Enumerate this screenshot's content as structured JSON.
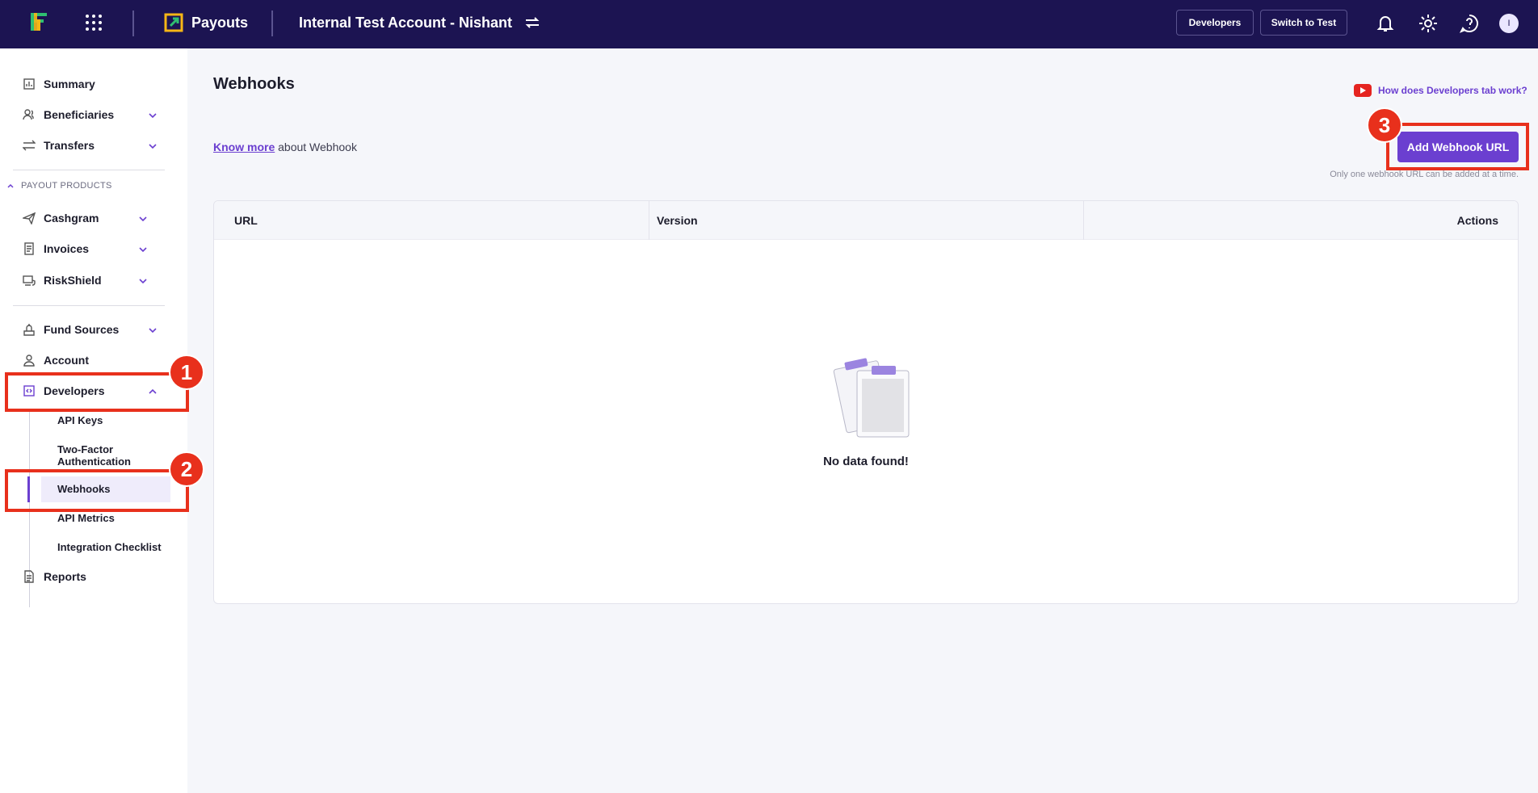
{
  "topbar": {
    "product_name": "Payouts",
    "account_name": "Internal Test Account - Nishant",
    "developers_label": "Developers",
    "switch_label": "Switch to Test",
    "avatar_initial": "I"
  },
  "sidebar": {
    "items": [
      {
        "label": "Summary",
        "icon": "summary-icon"
      },
      {
        "label": "Beneficiaries",
        "icon": "users-icon"
      },
      {
        "label": "Transfers",
        "icon": "transfer-icon"
      }
    ],
    "section_label": "PAYOUT PRODUCTS",
    "products": [
      {
        "label": "Cashgram",
        "icon": "send-icon"
      },
      {
        "label": "Invoices",
        "icon": "invoice-icon"
      },
      {
        "label": "RiskShield",
        "icon": "shield-icon"
      }
    ],
    "more": [
      {
        "label": "Fund Sources",
        "icon": "fund-icon"
      },
      {
        "label": "Account",
        "icon": "person-icon"
      },
      {
        "label": "Developers",
        "icon": "code-icon"
      }
    ],
    "dev_sub": [
      {
        "label": "API Keys"
      },
      {
        "label": "Two-Factor Authentication"
      },
      {
        "label": "Webhooks"
      },
      {
        "label": "API Metrics"
      },
      {
        "label": "Integration Checklist"
      }
    ],
    "reports": {
      "label": "Reports",
      "icon": "report-icon"
    }
  },
  "main": {
    "title": "Webhooks",
    "help_link": "How does Developers tab work?",
    "know_more_link": "Know more",
    "know_more_rest": " about Webhook",
    "add_button": "Add Webhook URL",
    "note": "Only one webhook URL can be added at a time.",
    "table": {
      "columns": [
        "URL",
        "Version",
        "Actions"
      ],
      "empty_text": "No data found!"
    }
  },
  "annotations": [
    "1",
    "2",
    "3"
  ],
  "colors": {
    "brand": "#1c1452",
    "accent": "#6b3fd0",
    "callout": "#e8301c"
  }
}
